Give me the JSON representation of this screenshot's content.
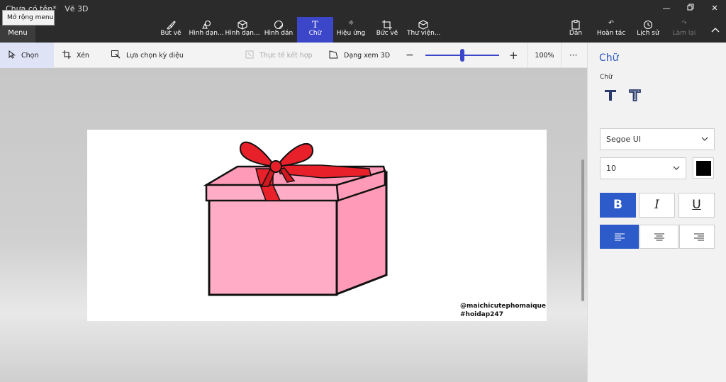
{
  "window": {
    "title": "Chưa có tên*",
    "app_name": "Vẽ 3D",
    "tooltip": "Mở rộng menu",
    "menu_label": "Menu"
  },
  "toolbar": {
    "tools": [
      {
        "label": "Bút vẽ"
      },
      {
        "label": "Hình dạn..."
      },
      {
        "label": "Hình dạn..."
      },
      {
        "label": "Hình dán"
      },
      {
        "label": "Chữ"
      },
      {
        "label": "Hiệu ứng"
      },
      {
        "label": "Bức vẽ"
      },
      {
        "label": "Thư viện..."
      }
    ],
    "right": [
      {
        "label": "Dán"
      },
      {
        "label": "Hoàn tác"
      },
      {
        "label": "Lịch sử"
      },
      {
        "label": "Làm lại"
      }
    ]
  },
  "subtoolbar": {
    "select": "Chọn",
    "crop": "Xén",
    "magic_select": "Lựa chọn kỳ diệu",
    "mixed_reality": "Thực tế kết hợp",
    "view_3d": "Dạng xem 3D",
    "zoom_level": "100%",
    "zoom_value": 0.5,
    "more": "···"
  },
  "canvas": {
    "watermark_line1": "@maichicutephomaique",
    "watermark_line2": "#hoidap247"
  },
  "panel": {
    "title": "Chữ",
    "subtitle": "Chữ",
    "font": "Segoe UI",
    "size": "10",
    "color": "#000000",
    "bold": "B",
    "italic": "I",
    "underline": "U"
  },
  "colors": {
    "accent": "#3b46c8",
    "box_pink": "#ffadc6",
    "ribbon_red": "#e8202a"
  }
}
